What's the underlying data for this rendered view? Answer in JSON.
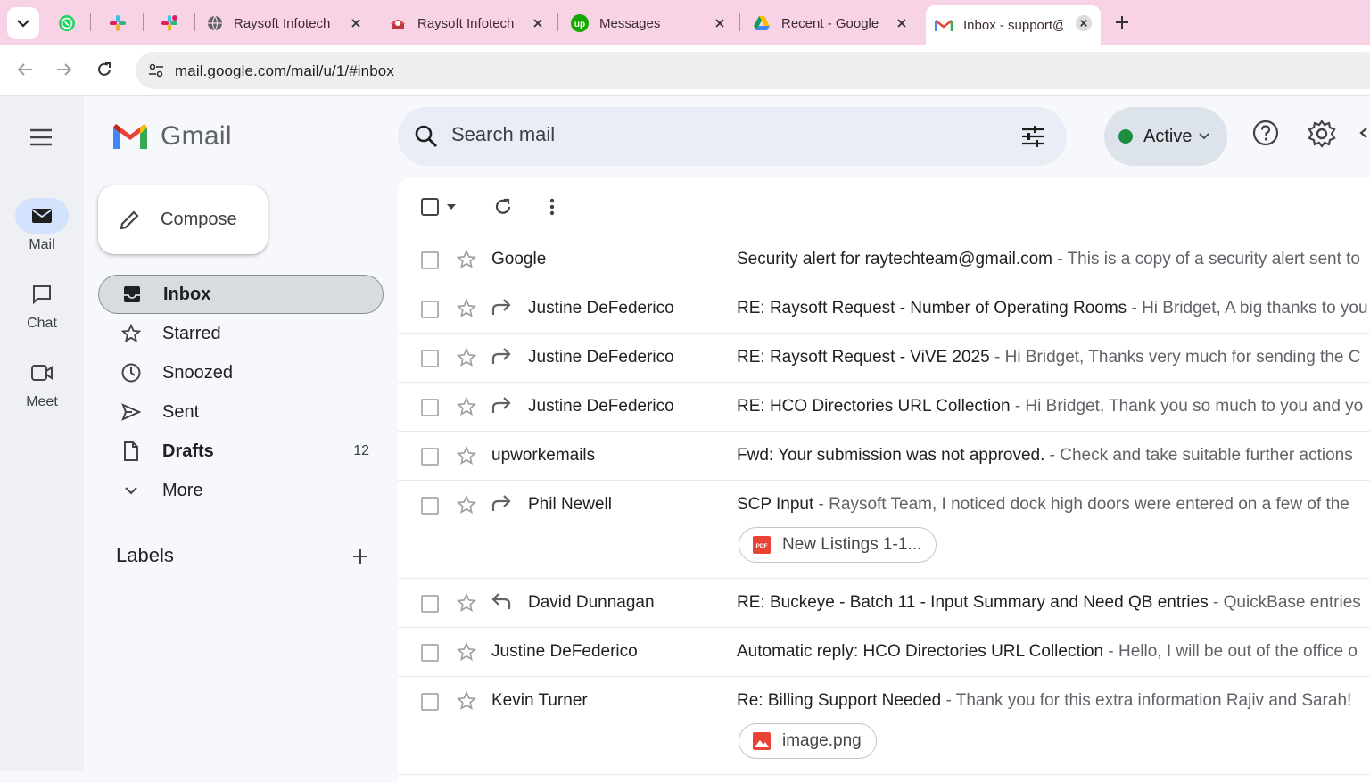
{
  "browser": {
    "tabs": [
      {
        "label": "Raysoft Infotech |",
        "icon": "globe-icon"
      },
      {
        "label": "Raysoft Infotech |",
        "icon": "raysoft-icon"
      },
      {
        "label": "Messages",
        "icon": "upwork-icon"
      },
      {
        "label": "Recent - Google D",
        "icon": "google-drive-icon"
      },
      {
        "label": "Inbox - support@",
        "icon": "gmail-icon",
        "active": true
      }
    ],
    "pinned_tabs": [
      "whatsapp-icon",
      "slack-icon",
      "slack-icon"
    ],
    "url": "mail.google.com/mail/u/1/#inbox"
  },
  "gmail": {
    "logo_text": "Gmail",
    "rail": [
      {
        "label": "Mail",
        "active": true
      },
      {
        "label": "Chat"
      },
      {
        "label": "Meet"
      }
    ],
    "compose_label": "Compose",
    "nav": [
      {
        "label": "Inbox",
        "active": true,
        "bold": true
      },
      {
        "label": "Starred"
      },
      {
        "label": "Snoozed"
      },
      {
        "label": "Sent"
      },
      {
        "label": "Drafts",
        "bold": true,
        "count": "12"
      },
      {
        "label": "More"
      }
    ],
    "labels_heading": "Labels",
    "search_placeholder": "Search mail",
    "status_label": "Active",
    "status_color": "#1e8e3e",
    "emails": [
      {
        "sender": "Google",
        "subject": "Security alert for raytechteam@gmail.com",
        "snippet": " - This is a copy of a security alert sent to"
      },
      {
        "sender": "Justine DeFederico",
        "forwarded": true,
        "subject": "RE: Raysoft Request - Number of Operating Rooms",
        "snippet": " - Hi Bridget, A big thanks to you"
      },
      {
        "sender": "Justine DeFederico",
        "forwarded": true,
        "subject": "RE: Raysoft Request - ViVE 2025",
        "snippet": " - Hi Bridget, Thanks very much for sending the C"
      },
      {
        "sender": "Justine DeFederico",
        "forwarded": true,
        "subject": "RE: HCO Directories URL Collection",
        "snippet": " - Hi Bridget, Thank you so much to you and yo"
      },
      {
        "sender": "upworkemails",
        "subject": "Fwd: Your submission was not approved.",
        "snippet": " - Check and take suitable further actions"
      },
      {
        "sender": "Phil Newell",
        "forwarded": true,
        "subject": "SCP Input",
        "snippet": " - Raysoft Team, I noticed dock high doors were entered on a few of the",
        "attachment": "New Listings 1-1..."
      },
      {
        "sender": "David Dunnagan",
        "replied": true,
        "subject": "RE: Buckeye - Batch 11 - Input Summary and Need QB entries",
        "snippet": " - QuickBase entries"
      },
      {
        "sender": "Justine DeFederico",
        "subject": "Automatic reply: HCO Directories URL Collection",
        "snippet": " - Hello, I will be out of the office o"
      },
      {
        "sender": "Kevin Turner",
        "subject": "Re: Billing Support Needed",
        "snippet": " - Thank you for this extra information Rajiv and Sarah!",
        "attachment": "image.png"
      }
    ]
  }
}
